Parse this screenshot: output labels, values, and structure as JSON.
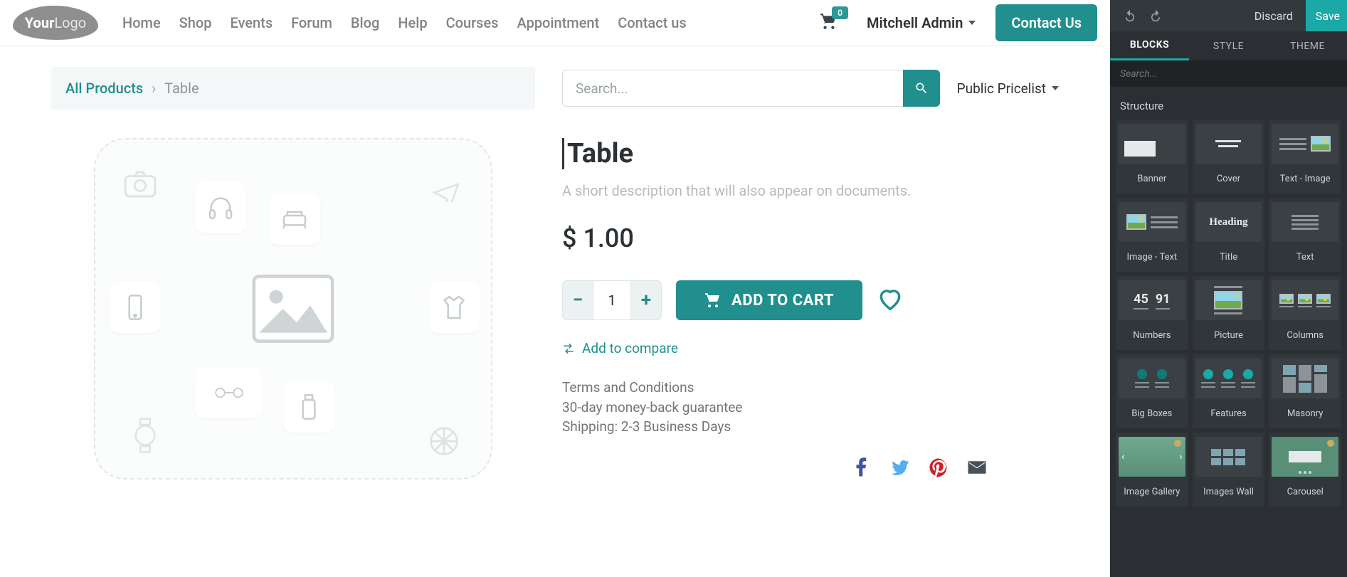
{
  "header": {
    "logo_main": "Your",
    "logo_sub": "Logo",
    "nav": [
      "Home",
      "Shop",
      "Events",
      "Forum",
      "Blog",
      "Help",
      "Courses",
      "Appointment",
      "Contact us"
    ],
    "cart_count": "0",
    "user": "Mitchell Admin",
    "contact_btn": "Contact Us"
  },
  "breadcrumb": {
    "root": "All Products",
    "current": "Table"
  },
  "search": {
    "placeholder": "Search...",
    "pricelist": "Public Pricelist"
  },
  "product": {
    "title": "Table",
    "desc": "A short description that will also appear on documents.",
    "price": "$ 1.00",
    "qty": "1",
    "add_to_cart": "ADD TO CART",
    "compare": "Add to compare",
    "terms1": "Terms and Conditions",
    "terms2": "30-day money-back guarantee",
    "terms3": "Shipping: 2-3 Business Days"
  },
  "panel": {
    "discard": "Discard",
    "save": "Save",
    "tabs": {
      "blocks": "BLOCKS",
      "style": "STYLE",
      "theme": "THEME"
    },
    "search_placeholder": "Search...",
    "section": "Structure",
    "blocks": [
      "Banner",
      "Cover",
      "Text - Image",
      "Image - Text",
      "Title",
      "Text",
      "Numbers",
      "Picture",
      "Columns",
      "Big Boxes",
      "Features",
      "Masonry",
      "Image Gallery",
      "Images Wall",
      "Carousel"
    ]
  }
}
